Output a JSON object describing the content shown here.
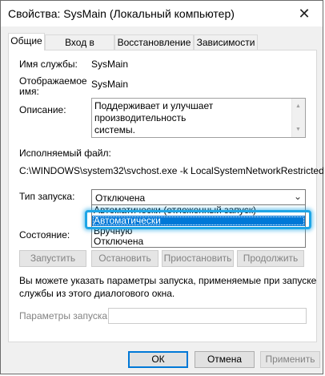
{
  "window": {
    "title": "Свойства: SysMain (Локальный компьютер)",
    "close_glyph": "✕"
  },
  "tabs": [
    {
      "label": "Общие",
      "active": true
    },
    {
      "label": "Вход в систему",
      "active": false
    },
    {
      "label": "Восстановление",
      "active": false
    },
    {
      "label": "Зависимости",
      "active": false
    }
  ],
  "general": {
    "service_name_label": "Имя службы:",
    "service_name_value": "SysMain",
    "display_name_label_line1": "Отображаемое",
    "display_name_label_line2": "имя:",
    "display_name_value": "SysMain",
    "description_label": "Описание:",
    "description_line1": "Поддерживает и улучшает производительность",
    "description_line2": "системы.",
    "exec_label": "Исполняемый файл:",
    "exec_path": "C:\\WINDOWS\\system32\\svchost.exe -k LocalSystemNetworkRestricted -p",
    "startup_label": "Тип запуска:",
    "startup_value": "Отключена",
    "startup_options": [
      "Автоматически (отложенный запуск)",
      "Автоматически",
      "Вручную",
      "Отключена"
    ],
    "startup_selected_index": 1,
    "status_label": "Состояние:",
    "buttons": {
      "start": "Запустить",
      "stop": "Остановить",
      "pause": "Приостановить",
      "resume": "Продолжить"
    },
    "hint_line1": "Вы можете указать параметры запуска, применяемые при запуске",
    "hint_line2": "службы из этого диалогового окна.",
    "start_params_label": "Параметры запуска:",
    "start_params_value": ""
  },
  "footer": {
    "ok": "ОК",
    "cancel": "Отмена",
    "apply": "Применить"
  },
  "colors": {
    "accent": "#0078d7",
    "highlight_ring": "#1ea5e6"
  }
}
